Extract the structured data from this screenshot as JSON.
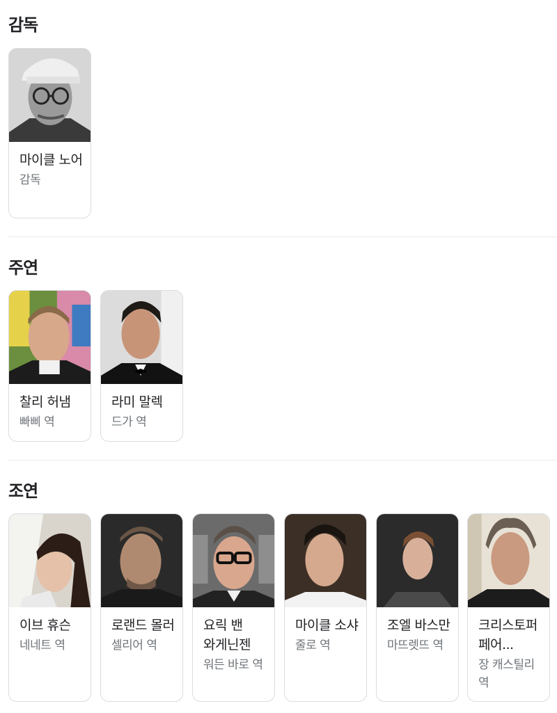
{
  "sections": [
    {
      "title": "감독",
      "people": [
        {
          "name": "마이클 노어",
          "role": "감독",
          "photo": "director-portrait-image"
        }
      ]
    },
    {
      "title": "주연",
      "people": [
        {
          "name": "찰리 허냄",
          "role": "빠삐 역",
          "photo": "actor-portrait-image"
        },
        {
          "name": "라미 말렉",
          "role": "드가 역",
          "photo": "actor-portrait-image"
        }
      ]
    },
    {
      "title": "조연",
      "people": [
        {
          "name": "이브 휴슨",
          "role": "네네트 역",
          "photo": "actor-portrait-image"
        },
        {
          "name": "로랜드 몰러",
          "role": "셀리어 역",
          "photo": "actor-portrait-image"
        },
        {
          "name": "요릭 밴 와게닌젠",
          "role": "워든 바로 역",
          "photo": "actor-portrait-image"
        },
        {
          "name": "마이클 소샤",
          "role": "줄로 역",
          "photo": "actor-portrait-image"
        },
        {
          "name": "조엘 바스만",
          "role": "마뜨렛뜨 역",
          "photo": "actor-portrait-image"
        },
        {
          "name": "크리스토퍼 페어...",
          "role": "장 캐스틸리 역",
          "photo": "actor-portrait-image"
        }
      ]
    }
  ],
  "colors": {
    "name": "#202124",
    "role": "#70757a",
    "border": "#dadce0",
    "divider": "#ebebeb"
  }
}
